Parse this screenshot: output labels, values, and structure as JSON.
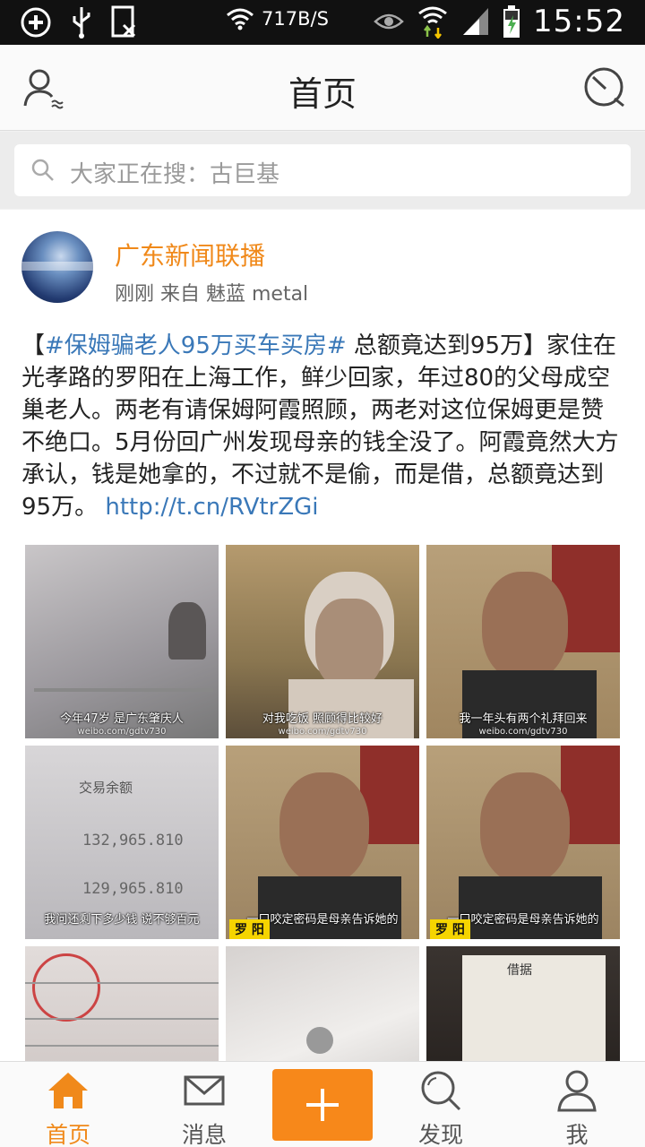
{
  "status_bar": {
    "net_speed": "717B/S",
    "time": "15:52"
  },
  "header": {
    "title": "首页",
    "left_icon": "user-friends-icon",
    "right_icon": "radar-icon"
  },
  "search": {
    "placeholder": "大家正在搜：古巨基"
  },
  "post": {
    "author": "广东新闻联播",
    "meta": "刚刚  来自 魅蓝 metal",
    "text_open": "【",
    "hashtag": "#保姆骗老人95万买车买房#",
    "text_body": " 总额竟达到95万】家住在光孝路的罗阳在上海工作，鲜少回家，年过80的父母成空巢老人。两老有请保姆阿霞照顾，两老对这位保姆更是赞不绝口。5月份回广州发现母亲的钱全没了。阿霞竟然大方承认，钱是她拿的，不过就不是偷，而是借，总额竟达到95万。",
    "link": "http://t.cn/RVtrZGi",
    "images": [
      {
        "caption": "今年47岁 是广东肇庆人",
        "watermark": "weibo.com/gdtv730"
      },
      {
        "caption": "对我吃饭 照顾得比较好",
        "watermark": "weibo.com/gdtv730"
      },
      {
        "caption": "我一年头有两个礼拜回来",
        "watermark": "weibo.com/gdtv730"
      },
      {
        "caption": "我问还剩下多少钱 说不够百元",
        "watermark": "",
        "label1": "交易余额",
        "num1": "132,965.810",
        "num2": "129,965.810"
      },
      {
        "caption": "一口咬定密码是母亲告诉她的",
        "watermark": "weibo.com/gdtv730",
        "name_tag": "罗 阳"
      },
      {
        "caption": "一口咬定密码是母亲告诉她的",
        "watermark": "weibo.com/gdtv730",
        "name_tag": "罗 阳"
      },
      {
        "caption": "",
        "watermark": ""
      },
      {
        "caption": "",
        "watermark": ""
      },
      {
        "caption": "",
        "watermark": "",
        "note": "借据"
      }
    ]
  },
  "bottom_nav": {
    "items": [
      {
        "label": "首页",
        "icon": "home-icon",
        "active": true
      },
      {
        "label": "消息",
        "icon": "mail-icon",
        "active": false
      },
      {
        "label": "",
        "icon": "plus-icon",
        "active": false
      },
      {
        "label": "发现",
        "icon": "discover-search-icon",
        "active": false
      },
      {
        "label": "我",
        "icon": "profile-icon",
        "active": false
      }
    ]
  },
  "colors": {
    "accent": "#f7881a",
    "link": "#3a78b8"
  }
}
